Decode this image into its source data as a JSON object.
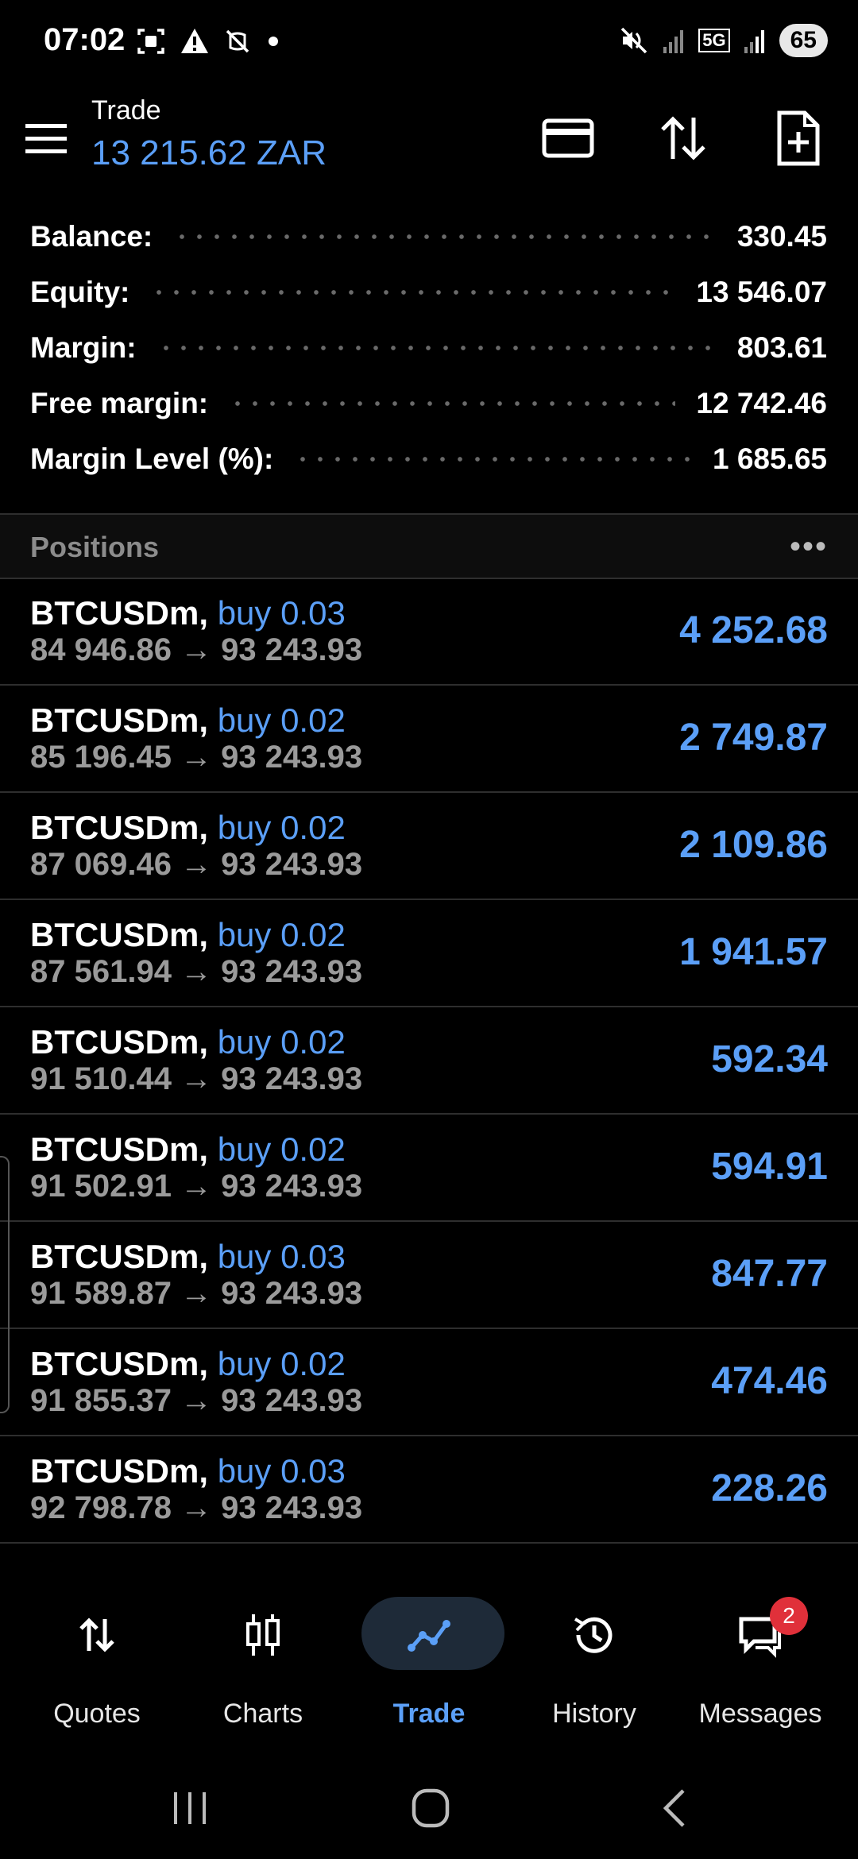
{
  "status_bar": {
    "time": "07:02",
    "network": "5G",
    "battery": "65"
  },
  "header": {
    "title": "Trade",
    "subtitle": "13 215.62 ZAR"
  },
  "summary": [
    {
      "label": "Balance:",
      "value": "330.45"
    },
    {
      "label": "Equity:",
      "value": "13 546.07"
    },
    {
      "label": "Margin:",
      "value": "803.61"
    },
    {
      "label": "Free margin:",
      "value": "12 742.46"
    },
    {
      "label": "Margin Level (%):",
      "value": "1 685.65"
    }
  ],
  "positions": {
    "title": "Positions",
    "more": "•••",
    "rows": [
      {
        "symbol": "BTCUSDm,",
        "type": "buy 0.03",
        "prices": "84 946.86 → 93 243.93",
        "profit": "4 252.68"
      },
      {
        "symbol": "BTCUSDm,",
        "type": "buy 0.02",
        "prices": "85 196.45 → 93 243.93",
        "profit": "2 749.87"
      },
      {
        "symbol": "BTCUSDm,",
        "type": "buy 0.02",
        "prices": "87 069.46 → 93 243.93",
        "profit": "2 109.86"
      },
      {
        "symbol": "BTCUSDm,",
        "type": "buy 0.02",
        "prices": "87 561.94 → 93 243.93",
        "profit": "1 941.57"
      },
      {
        "symbol": "BTCUSDm,",
        "type": "buy 0.02",
        "prices": "91 510.44 → 93 243.93",
        "profit": "592.34"
      },
      {
        "symbol": "BTCUSDm,",
        "type": "buy 0.02",
        "prices": "91 502.91 → 93 243.93",
        "profit": "594.91"
      },
      {
        "symbol": "BTCUSDm,",
        "type": "buy 0.03",
        "prices": "91 589.87 → 93 243.93",
        "profit": "847.77"
      },
      {
        "symbol": "BTCUSDm,",
        "type": "buy 0.02",
        "prices": "91 855.37 → 93 243.93",
        "profit": "474.46"
      },
      {
        "symbol": "BTCUSDm,",
        "type": "buy 0.03",
        "prices": "92 798.78 → 93 243.93",
        "profit": "228.26"
      }
    ]
  },
  "nav": {
    "quotes": "Quotes",
    "charts": "Charts",
    "trade": "Trade",
    "history": "History",
    "messages": "Messages",
    "messages_badge": "2"
  },
  "colors": {
    "accent": "#5b9ff7",
    "background": "#000000",
    "badge": "#e0303a"
  }
}
